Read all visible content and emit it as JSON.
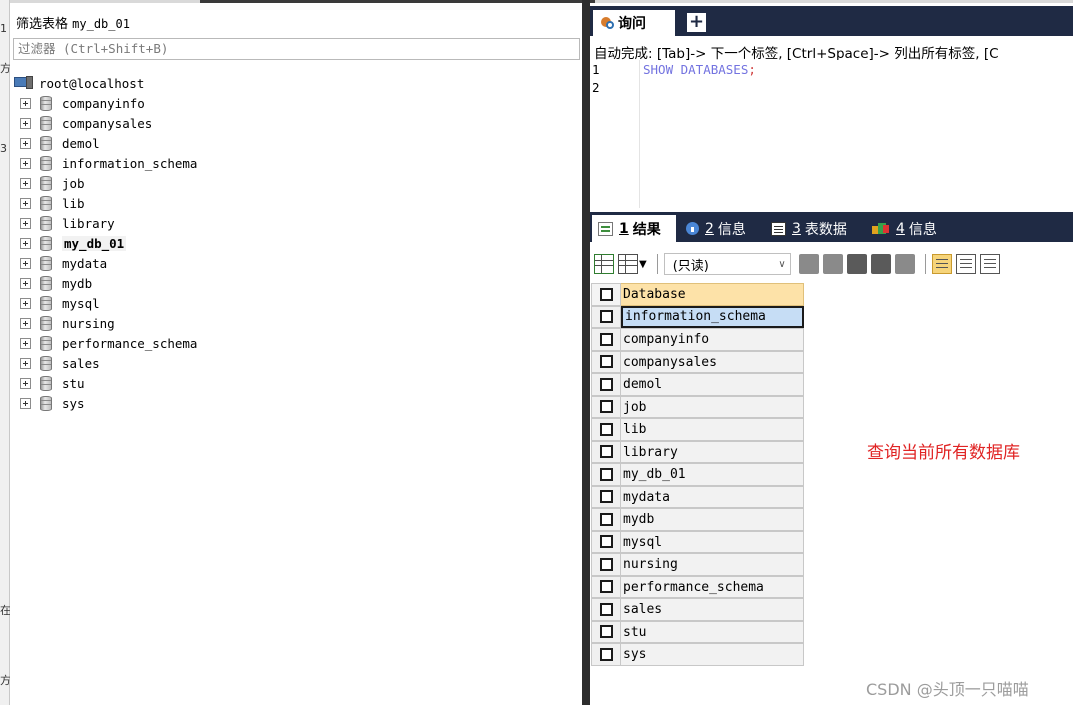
{
  "window_edge": {
    "fragments": [
      "1",
      "方",
      "⺠",
      "3",
      "在",
      "方"
    ]
  },
  "left_panel": {
    "filter_title": "筛选表格",
    "filter_title_value": "my_db_01",
    "filter_placeholder": "过滤器 (Ctrl+Shift+B)",
    "connection": "root@localhost",
    "databases": [
      {
        "name": "companyinfo",
        "bold": false
      },
      {
        "name": "companysales",
        "bold": false
      },
      {
        "name": "demol",
        "bold": false
      },
      {
        "name": "information_schema",
        "bold": false
      },
      {
        "name": "job",
        "bold": false
      },
      {
        "name": "lib",
        "bold": false
      },
      {
        "name": "library",
        "bold": false
      },
      {
        "name": "my_db_01",
        "bold": true
      },
      {
        "name": "mydata",
        "bold": false
      },
      {
        "name": "mydb",
        "bold": false
      },
      {
        "name": "mysql",
        "bold": false
      },
      {
        "name": "nursing",
        "bold": false
      },
      {
        "name": "performance_schema",
        "bold": false
      },
      {
        "name": "sales",
        "bold": false
      },
      {
        "name": "stu",
        "bold": false
      },
      {
        "name": "sys",
        "bold": false
      }
    ]
  },
  "query_panel": {
    "tab_label": "询问",
    "new_tab_label": "+",
    "autocomplete_hint": "自动完成: [Tab]-> 下一个标签, [Ctrl+Space]-> 列出所有标签, [C",
    "line_numbers": [
      "1",
      "2"
    ],
    "code": {
      "keyword": "SHOW DATABASES",
      "terminator": ";"
    }
  },
  "result_tabs": [
    {
      "num": "1",
      "label": "结果",
      "active": true,
      "icon": "result-icon"
    },
    {
      "num": "2",
      "label": "信息",
      "active": false,
      "icon": "info-icon"
    },
    {
      "num": "3",
      "label": "表数据",
      "active": false,
      "icon": "table-data-icon"
    },
    {
      "num": "4",
      "label": "信息",
      "active": false,
      "icon": "info-chart-icon"
    }
  ],
  "result_toolbar": {
    "mode": "(只读)",
    "icons": [
      "export-grid-icon",
      "import-icon",
      "dropdown-icon",
      "add-row-icon",
      "copy-row-icon",
      "save-icon",
      "delete-icon",
      "discard-icon",
      "grid-view-icon",
      "form-view-icon",
      "text-view-icon"
    ]
  },
  "results_grid": {
    "header": "Database",
    "rows": [
      "information_schema",
      "companyinfo",
      "companysales",
      "demol",
      "job",
      "lib",
      "library",
      "my_db_01",
      "mydata",
      "mydb",
      "mysql",
      "nursing",
      "performance_schema",
      "sales",
      "stu",
      "sys"
    ],
    "selected_row": 0
  },
  "annotation_text": "查询当前所有数据库",
  "watermark_text": "CSDN @头顶一只喵喵",
  "colors": {
    "tab_bar_bg": "#1f2a44",
    "header_cell_bg": "#fde2a8",
    "selected_cell_bg": "#c6ddf5",
    "annotation": "#e02424",
    "sql_keyword": "#7373e0",
    "sql_terminator": "#d04040"
  }
}
